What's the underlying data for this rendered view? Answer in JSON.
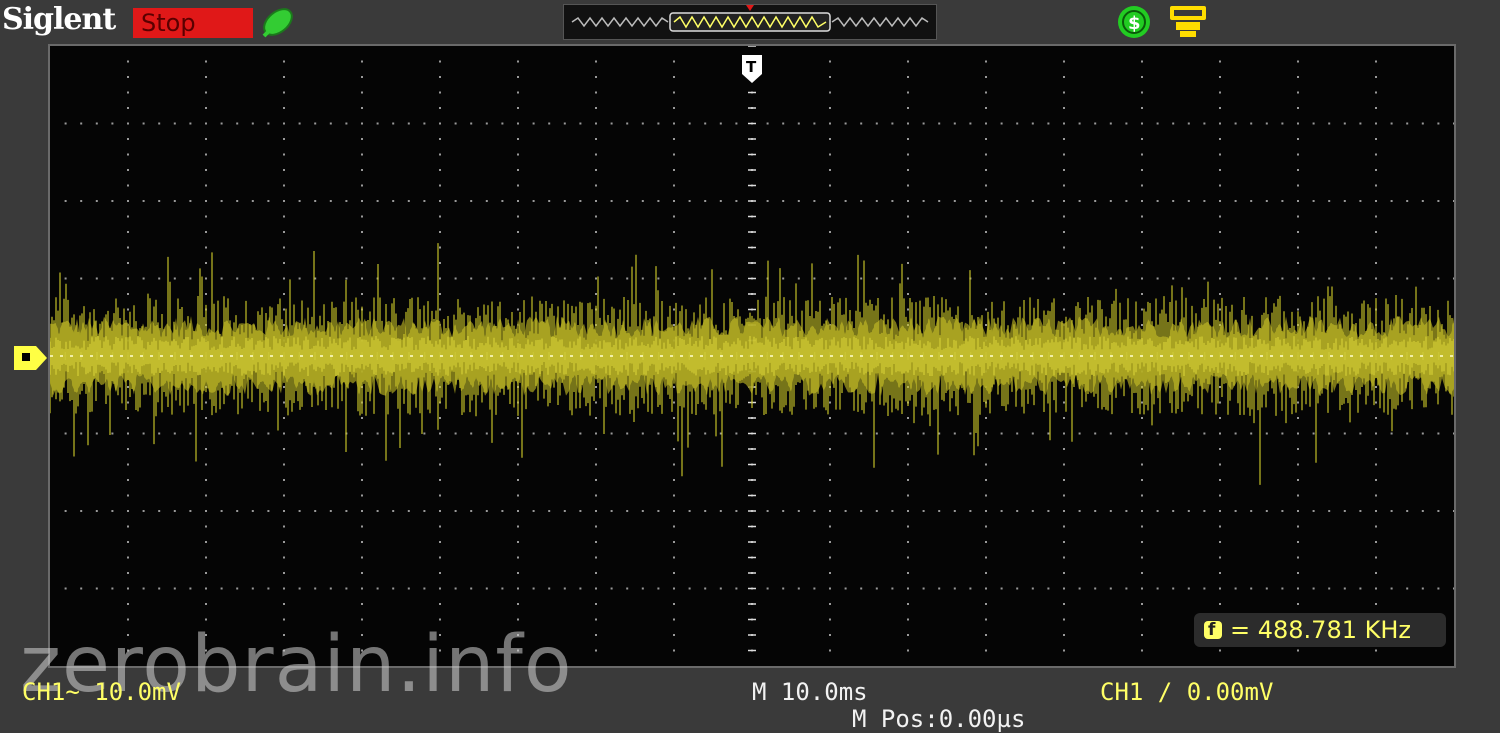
{
  "brand": "Siglent",
  "run_status": "Stop",
  "colors": {
    "ch1": "#ffff66",
    "trace": "#c8c228",
    "stop_bg": "#e01818",
    "screen_bg": "#050505",
    "grid": "#9a9a9a"
  },
  "icons": {
    "probe": "probe-icon",
    "trigger_source": "dollar-circle-icon",
    "usb": "usb-icon",
    "trigger_marker": "trigger-marker-icon",
    "ch1_level": "ch1-level-marker-icon",
    "frequency": "frequency-icon"
  },
  "screen": {
    "trigger_marker": "T",
    "frequency_readout": "= 488.781 KHz"
  },
  "bottom": {
    "ch1_scale": "CH1~ 10.0mV",
    "timebase": "M 10.0ms",
    "trigger_level": "CH1 ∕ 0.00mV",
    "m_pos": "M Pos:0.00µs"
  },
  "watermark": "zerobrain.info"
}
